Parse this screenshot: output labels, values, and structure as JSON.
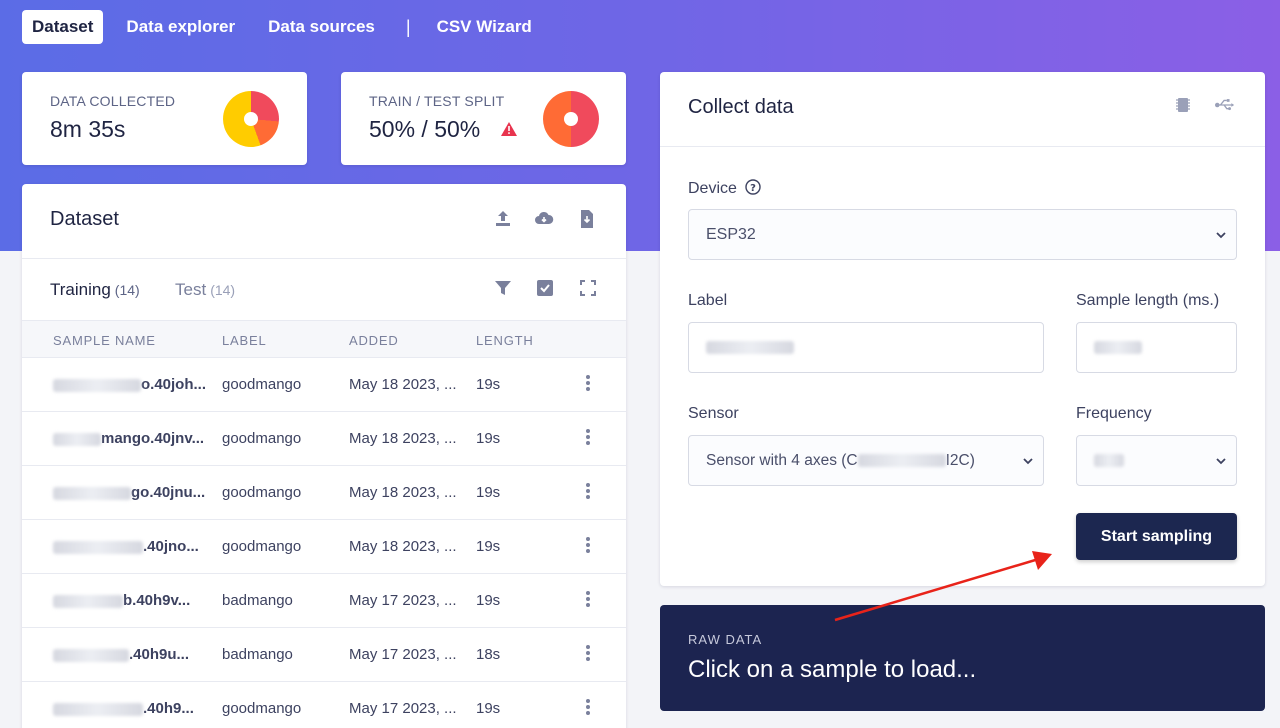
{
  "nav": {
    "tabs": [
      {
        "label": "Dataset",
        "active": true
      },
      {
        "label": "Data explorer"
      },
      {
        "label": "Data sources"
      },
      {
        "label": "CSV Wizard"
      }
    ],
    "separator": "|"
  },
  "stats": {
    "collected": {
      "label": "DATA COLLECTED",
      "value": "8m 35s"
    },
    "split": {
      "label": "TRAIN / TEST SPLIT",
      "value": "50% / 50%",
      "warning_icon": "warning-triangle-icon"
    }
  },
  "dataset": {
    "title": "Dataset",
    "icons": [
      "upload-icon",
      "cloud-download-icon",
      "file-export-icon"
    ],
    "tabs": [
      {
        "label": "Training",
        "count": "(14)",
        "active": true
      },
      {
        "label": "Test",
        "count": "(14)"
      }
    ],
    "tool_icons": [
      "filter-icon",
      "checkbox-icon",
      "expand-icon"
    ],
    "columns": [
      "SAMPLE NAME",
      "LABEL",
      "ADDED",
      "LENGTH"
    ],
    "rows": [
      {
        "name": "o.40joh...",
        "label": "goodmango",
        "added": "May 18 2023, ...",
        "length": "19s"
      },
      {
        "name": "mango.40jnv...",
        "label": "goodmango",
        "added": "May 18 2023, ...",
        "length": "19s"
      },
      {
        "name": "go.40jnu...",
        "label": "goodmango",
        "added": "May 18 2023, ...",
        "length": "19s"
      },
      {
        "name": ".40jno...",
        "label": "goodmango",
        "added": "May 18 2023, ...",
        "length": "19s"
      },
      {
        "name": "b.40h9v...",
        "label": "badmango",
        "added": "May 17 2023, ...",
        "length": "19s"
      },
      {
        "name": ".40h9u...",
        "label": "badmango",
        "added": "May 17 2023, ...",
        "length": "18s"
      },
      {
        "name": ".40h9...",
        "label": "goodmango",
        "added": "May 17 2023, ...",
        "length": "19s"
      }
    ]
  },
  "collect": {
    "title": "Collect data",
    "header_icons": [
      "chip-icon",
      "usb-icon"
    ],
    "device_label": "Device",
    "device_value": "ESP32",
    "label_label": "Label",
    "label_value": "",
    "sample_length_label": "Sample length (ms.)",
    "sample_length_value": "",
    "sensor_label": "Sensor",
    "sensor_value": "Sensor with 4 axes (C",
    "sensor_value_tail": "I2C)",
    "frequency_label": "Frequency",
    "frequency_value": "",
    "start_button": "Start sampling"
  },
  "raw": {
    "label": "RAW DATA",
    "message": "Click on a sample to load..."
  },
  "colors": {
    "accent": "#1c2750",
    "pie_yellow": "#ffcc00",
    "pie_red": "#f04a5c",
    "pie_orange": "#ff6b35",
    "warning": "#e8344e"
  }
}
